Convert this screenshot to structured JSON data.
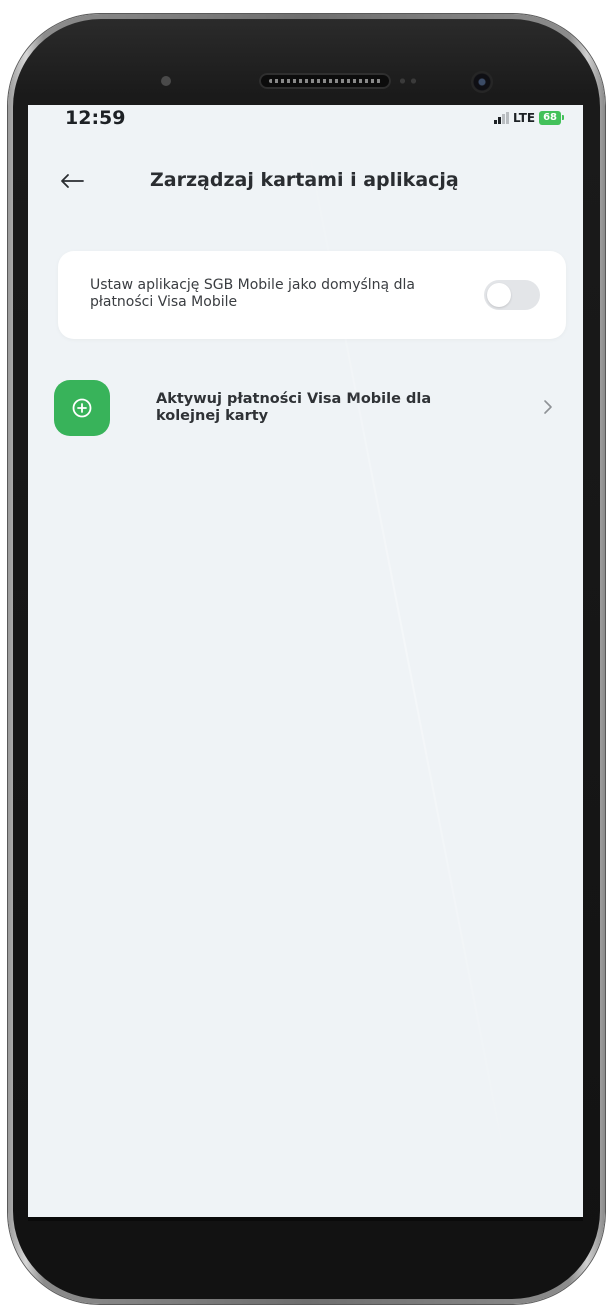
{
  "status_bar": {
    "time": "12:59",
    "network": "LTE",
    "battery": "68"
  },
  "header": {
    "back_icon": "arrow-left-icon",
    "title": "Zarządzaj kartami i aplikacją"
  },
  "default_app_setting": {
    "label": "Ustaw aplikację SGB Mobile jako domyślną dla płatności Visa Mobile",
    "toggle_on": false
  },
  "activate_action": {
    "icon": "plus-circle-icon",
    "label": "Aktywuj płatności Visa Mobile dla kolejnej karty",
    "chevron_icon": "chevron-right-icon"
  },
  "colors": {
    "accent_green": "#38b35a",
    "screen_background": "#eff3f6",
    "card_background": "#ffffff",
    "toggle_off": "#e3e5e8"
  }
}
